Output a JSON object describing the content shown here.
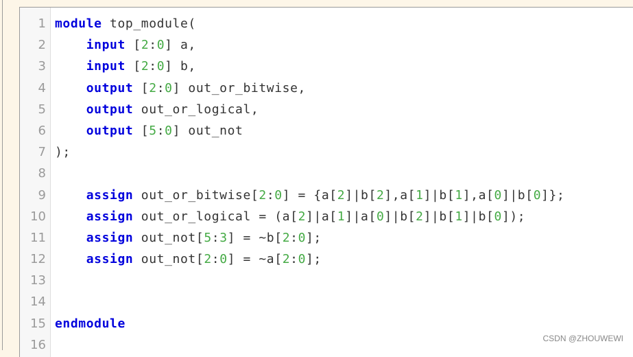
{
  "editor": {
    "language": "verilog",
    "colors": {
      "keyword": "#0000dd",
      "number": "#44aa44",
      "text": "#333333",
      "line_number": "#9a9a9a",
      "frame_background": "#fdf6e8"
    },
    "lines": [
      {
        "number": "1",
        "tokens": [
          {
            "t": "kw",
            "v": "module"
          },
          {
            "t": "txt",
            "v": " top_module("
          }
        ]
      },
      {
        "number": "2",
        "tokens": [
          {
            "t": "txt",
            "v": "    "
          },
          {
            "t": "kw",
            "v": "input"
          },
          {
            "t": "txt",
            "v": " ["
          },
          {
            "t": "num",
            "v": "2"
          },
          {
            "t": "txt",
            "v": ":"
          },
          {
            "t": "num",
            "v": "0"
          },
          {
            "t": "txt",
            "v": "] a,"
          }
        ]
      },
      {
        "number": "3",
        "tokens": [
          {
            "t": "txt",
            "v": "    "
          },
          {
            "t": "kw",
            "v": "input"
          },
          {
            "t": "txt",
            "v": " ["
          },
          {
            "t": "num",
            "v": "2"
          },
          {
            "t": "txt",
            "v": ":"
          },
          {
            "t": "num",
            "v": "0"
          },
          {
            "t": "txt",
            "v": "] b,"
          }
        ]
      },
      {
        "number": "4",
        "tokens": [
          {
            "t": "txt",
            "v": "    "
          },
          {
            "t": "kw",
            "v": "output"
          },
          {
            "t": "txt",
            "v": " ["
          },
          {
            "t": "num",
            "v": "2"
          },
          {
            "t": "txt",
            "v": ":"
          },
          {
            "t": "num",
            "v": "0"
          },
          {
            "t": "txt",
            "v": "] out_or_bitwise,"
          }
        ]
      },
      {
        "number": "5",
        "tokens": [
          {
            "t": "txt",
            "v": "    "
          },
          {
            "t": "kw",
            "v": "output"
          },
          {
            "t": "txt",
            "v": " out_or_logical,"
          }
        ]
      },
      {
        "number": "6",
        "tokens": [
          {
            "t": "txt",
            "v": "    "
          },
          {
            "t": "kw",
            "v": "output"
          },
          {
            "t": "txt",
            "v": " ["
          },
          {
            "t": "num",
            "v": "5"
          },
          {
            "t": "txt",
            "v": ":"
          },
          {
            "t": "num",
            "v": "0"
          },
          {
            "t": "txt",
            "v": "] out_not"
          }
        ]
      },
      {
        "number": "7",
        "tokens": [
          {
            "t": "txt",
            "v": ");"
          }
        ]
      },
      {
        "number": "8",
        "tokens": []
      },
      {
        "number": "9",
        "tokens": [
          {
            "t": "txt",
            "v": "    "
          },
          {
            "t": "kw",
            "v": "assign"
          },
          {
            "t": "txt",
            "v": " out_or_bitwise["
          },
          {
            "t": "num",
            "v": "2"
          },
          {
            "t": "txt",
            "v": ":"
          },
          {
            "t": "num",
            "v": "0"
          },
          {
            "t": "txt",
            "v": "] = {a["
          },
          {
            "t": "num",
            "v": "2"
          },
          {
            "t": "txt",
            "v": "]|b["
          },
          {
            "t": "num",
            "v": "2"
          },
          {
            "t": "txt",
            "v": "],a["
          },
          {
            "t": "num",
            "v": "1"
          },
          {
            "t": "txt",
            "v": "]|b["
          },
          {
            "t": "num",
            "v": "1"
          },
          {
            "t": "txt",
            "v": "],a["
          },
          {
            "t": "num",
            "v": "0"
          },
          {
            "t": "txt",
            "v": "]|b["
          },
          {
            "t": "num",
            "v": "0"
          },
          {
            "t": "txt",
            "v": "]};"
          }
        ]
      },
      {
        "number": "10",
        "tokens": [
          {
            "t": "txt",
            "v": "    "
          },
          {
            "t": "kw",
            "v": "assign"
          },
          {
            "t": "txt",
            "v": " out_or_logical = (a["
          },
          {
            "t": "num",
            "v": "2"
          },
          {
            "t": "txt",
            "v": "]|a["
          },
          {
            "t": "num",
            "v": "1"
          },
          {
            "t": "txt",
            "v": "]|a["
          },
          {
            "t": "num",
            "v": "0"
          },
          {
            "t": "txt",
            "v": "]|b["
          },
          {
            "t": "num",
            "v": "2"
          },
          {
            "t": "txt",
            "v": "]|b["
          },
          {
            "t": "num",
            "v": "1"
          },
          {
            "t": "txt",
            "v": "]|b["
          },
          {
            "t": "num",
            "v": "0"
          },
          {
            "t": "txt",
            "v": "]);"
          }
        ]
      },
      {
        "number": "11",
        "tokens": [
          {
            "t": "txt",
            "v": "    "
          },
          {
            "t": "kw",
            "v": "assign"
          },
          {
            "t": "txt",
            "v": " out_not["
          },
          {
            "t": "num",
            "v": "5"
          },
          {
            "t": "txt",
            "v": ":"
          },
          {
            "t": "num",
            "v": "3"
          },
          {
            "t": "txt",
            "v": "] = ~b["
          },
          {
            "t": "num",
            "v": "2"
          },
          {
            "t": "txt",
            "v": ":"
          },
          {
            "t": "num",
            "v": "0"
          },
          {
            "t": "txt",
            "v": "];"
          }
        ]
      },
      {
        "number": "12",
        "tokens": [
          {
            "t": "txt",
            "v": "    "
          },
          {
            "t": "kw",
            "v": "assign"
          },
          {
            "t": "txt",
            "v": " out_not["
          },
          {
            "t": "num",
            "v": "2"
          },
          {
            "t": "txt",
            "v": ":"
          },
          {
            "t": "num",
            "v": "0"
          },
          {
            "t": "txt",
            "v": "] = ~a["
          },
          {
            "t": "num",
            "v": "2"
          },
          {
            "t": "txt",
            "v": ":"
          },
          {
            "t": "num",
            "v": "0"
          },
          {
            "t": "txt",
            "v": "];"
          }
        ]
      },
      {
        "number": "13",
        "tokens": []
      },
      {
        "number": "14",
        "tokens": []
      },
      {
        "number": "15",
        "tokens": [
          {
            "t": "kw",
            "v": "endmodule"
          }
        ]
      },
      {
        "number": "16",
        "tokens": []
      }
    ]
  },
  "watermark": "CSDN @ZHOUWEWI"
}
